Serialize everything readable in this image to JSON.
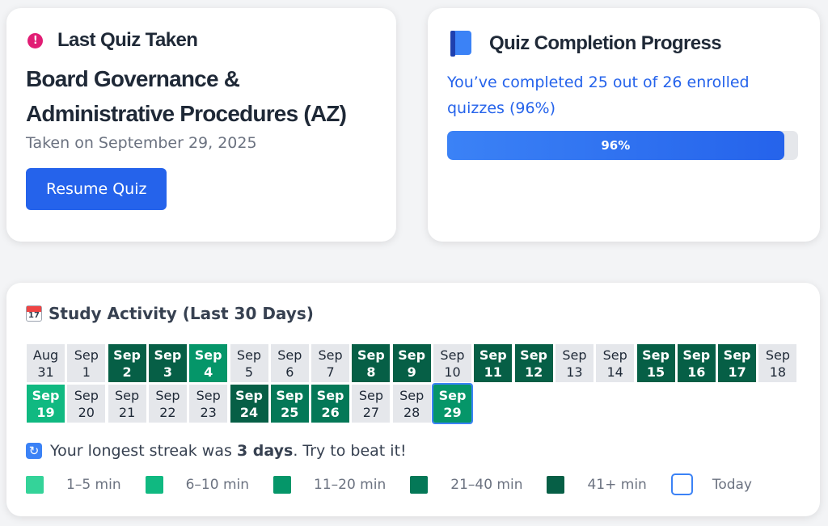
{
  "last_quiz": {
    "heading": "Last Quiz Taken",
    "quiz_name": "Board Governance & Administrative Procedures (AZ)",
    "taken_date": "Taken on September 29, 2025",
    "resume_label": "Resume Quiz"
  },
  "progress": {
    "heading": "Quiz Completion Progress",
    "summary": "You’ve completed 25 out of 26 enrolled quizzes (96%)",
    "percent": 96,
    "percent_label": "96%"
  },
  "activity": {
    "heading": "Study Activity (Last 30 Days)",
    "calendar_icon_day": "17",
    "days": [
      {
        "month": "Aug",
        "day": "31",
        "level": 0
      },
      {
        "month": "Sep",
        "day": "1",
        "level": 0
      },
      {
        "month": "Sep",
        "day": "2",
        "level": 5
      },
      {
        "month": "Sep",
        "day": "3",
        "level": 5
      },
      {
        "month": "Sep",
        "day": "4",
        "level": 3
      },
      {
        "month": "Sep",
        "day": "5",
        "level": 0
      },
      {
        "month": "Sep",
        "day": "6",
        "level": 0
      },
      {
        "month": "Sep",
        "day": "7",
        "level": 0
      },
      {
        "month": "Sep",
        "day": "8",
        "level": 5
      },
      {
        "month": "Sep",
        "day": "9",
        "level": 5
      },
      {
        "month": "Sep",
        "day": "10",
        "level": 0
      },
      {
        "month": "Sep",
        "day": "11",
        "level": 5
      },
      {
        "month": "Sep",
        "day": "12",
        "level": 5
      },
      {
        "month": "Sep",
        "day": "13",
        "level": 0
      },
      {
        "month": "Sep",
        "day": "14",
        "level": 0
      },
      {
        "month": "Sep",
        "day": "15",
        "level": 5
      },
      {
        "month": "Sep",
        "day": "16",
        "level": 5
      },
      {
        "month": "Sep",
        "day": "17",
        "level": 5
      },
      {
        "month": "Sep",
        "day": "18",
        "level": 0
      },
      {
        "month": "Sep",
        "day": "19",
        "level": 2
      },
      {
        "month": "Sep",
        "day": "20",
        "level": 0
      },
      {
        "month": "Sep",
        "day": "21",
        "level": 0
      },
      {
        "month": "Sep",
        "day": "22",
        "level": 0
      },
      {
        "month": "Sep",
        "day": "23",
        "level": 0
      },
      {
        "month": "Sep",
        "day": "24",
        "level": 5
      },
      {
        "month": "Sep",
        "day": "25",
        "level": 4
      },
      {
        "month": "Sep",
        "day": "26",
        "level": 4
      },
      {
        "month": "Sep",
        "day": "27",
        "level": 0
      },
      {
        "month": "Sep",
        "day": "28",
        "level": 0
      },
      {
        "month": "Sep",
        "day": "29",
        "level": 3,
        "today": true
      }
    ],
    "streak": {
      "prefix": "Your longest streak was ",
      "value": "3 days",
      "suffix": ". Try to beat it!"
    },
    "legend": [
      {
        "label": "1–5 min",
        "color": "#34d399"
      },
      {
        "label": "6–10 min",
        "color": "#10b981"
      },
      {
        "label": "11–20 min",
        "color": "#059669"
      },
      {
        "label": "21–40 min",
        "color": "#047857"
      },
      {
        "label": "41+ min",
        "color": "#065f46"
      },
      {
        "label": "Today",
        "color": "#3b82f6",
        "outline": true
      }
    ]
  },
  "colors": {
    "accent": "#2563eb",
    "alert": "#e11d74"
  }
}
